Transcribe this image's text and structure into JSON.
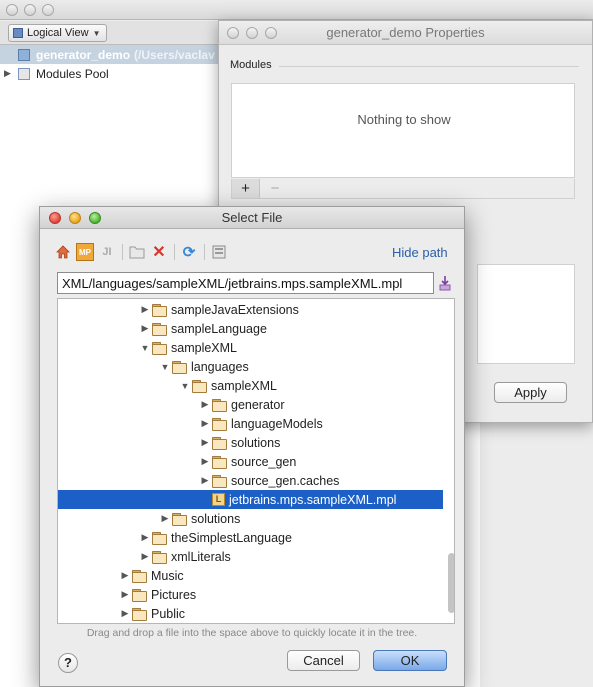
{
  "ide": {
    "view_selector": "Logical View",
    "project_name": "generator_demo",
    "project_path": "(/Users/vaclav",
    "modules_pool": "Modules Pool"
  },
  "properties": {
    "title": "generator_demo Properties",
    "modules_label": "Modules",
    "empty_text": "Nothing to show",
    "add_label": "+",
    "remove_label": "−",
    "apply_label": "Apply"
  },
  "dialog": {
    "title": "Select File",
    "hide_path": "Hide path",
    "path_value": "XML/languages/sampleXML/jetbrains.mps.sampleXML.mpl",
    "hint": "Drag and drop a file into the space above to quickly locate it in the tree.",
    "help_label": "?",
    "cancel_label": "Cancel",
    "ok_label": "OK",
    "tree": [
      {
        "label": "sampleJavaExtensions",
        "expanded": false,
        "selected": false
      },
      {
        "label": "sampleLanguage",
        "expanded": false,
        "selected": false
      },
      {
        "label": "sampleXML",
        "expanded": true,
        "selected": false
      },
      {
        "label": "languages",
        "expanded": true,
        "selected": false
      },
      {
        "label": "sampleXML",
        "expanded": true,
        "selected": false
      },
      {
        "label": "generator",
        "expanded": false,
        "selected": false
      },
      {
        "label": "languageModels",
        "expanded": false,
        "selected": false
      },
      {
        "label": "solutions",
        "expanded": false,
        "selected": false
      },
      {
        "label": "source_gen",
        "expanded": false,
        "selected": false
      },
      {
        "label": "source_gen.caches",
        "expanded": false,
        "selected": false
      },
      {
        "label": "jetbrains.mps.sampleXML.mpl",
        "expanded": false,
        "selected": true
      },
      {
        "label": "solutions",
        "expanded": false,
        "selected": false
      },
      {
        "label": "theSimplestLanguage",
        "expanded": false,
        "selected": false
      },
      {
        "label": "xmlLiterals",
        "expanded": false,
        "selected": false
      },
      {
        "label": "Music",
        "expanded": false,
        "selected": false
      },
      {
        "label": "Pictures",
        "expanded": false,
        "selected": false
      },
      {
        "label": "Public",
        "expanded": false,
        "selected": false
      }
    ]
  },
  "colors": {
    "selection": "#1c5fc7",
    "link": "#2b60a6",
    "ok_button": "#79a9ea"
  }
}
